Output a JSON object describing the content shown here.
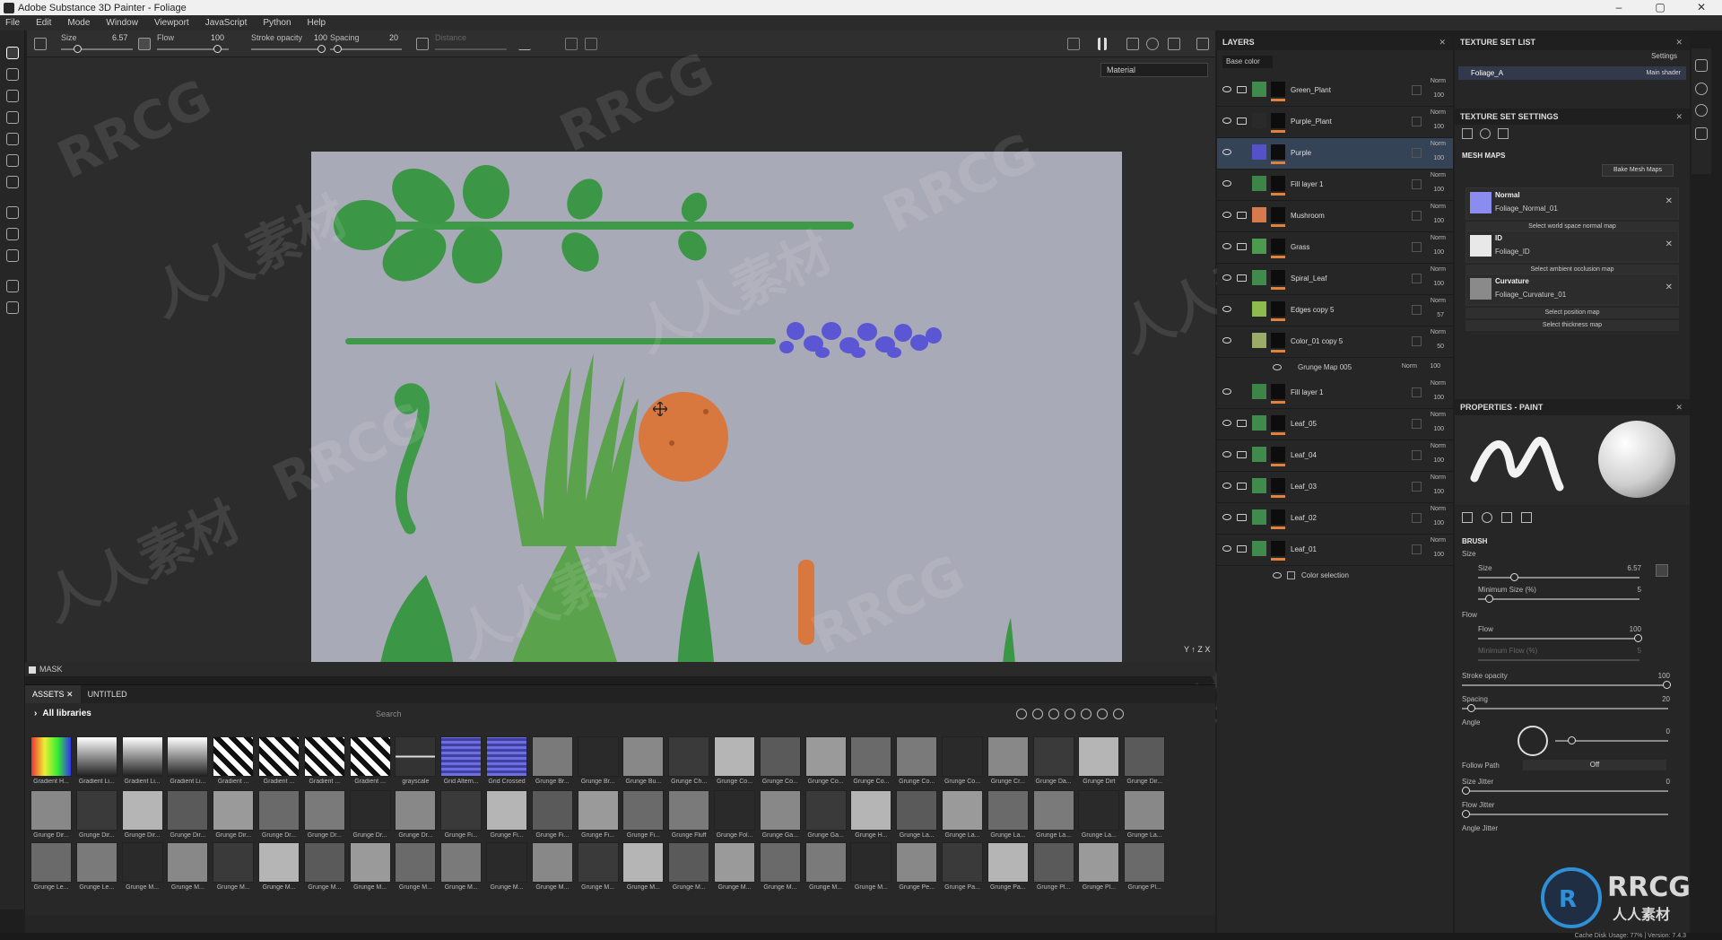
{
  "window": {
    "title": "Adobe Substance 3D Painter - Foliage",
    "min": "–",
    "max": "▢",
    "close": "✕"
  },
  "menu": [
    "File",
    "Edit",
    "Mode",
    "Window",
    "Viewport",
    "JavaScript",
    "Python",
    "Help"
  ],
  "toolbar": {
    "size_label": "Size",
    "size_value": "6.57",
    "flow_label": "Flow",
    "flow_value": "100",
    "stroke_label": "Stroke opacity",
    "stroke_value": "100",
    "spacing_label": "Spacing",
    "spacing_value": "20",
    "distance_label": "Distance"
  },
  "viewport": {
    "material_select": "Material",
    "axis_label": "Y ↑ Z X"
  },
  "watermarks": [
    "RRCG",
    "人人素材",
    "RRCG",
    "人人素材",
    "RRCG",
    "人人素材",
    "RRCG",
    "人人素材",
    "RRCG",
    "人人素材",
    "RRCG",
    "人人素材"
  ],
  "mask_bar": {
    "label": "MASK"
  },
  "assets": {
    "tabs": [
      "ASSETS",
      "UNTITLED"
    ],
    "library": "All libraries",
    "search_placeholder": "Search",
    "rows": [
      [
        "Gradient H...",
        "Gradient Li...",
        "Gradient Li...",
        "Gradient Li...",
        "Gradient ...",
        "Gradient ...",
        "Gradient ...",
        "Gradient ...",
        "grayscale",
        "Grid Altern...",
        "Grid Crossed",
        "Grunge Br...",
        "Grunge Br...",
        "Grunge Bu...",
        "Grunge Ch...",
        "Grunge Co...",
        "Grunge Co...",
        "Grunge Co...",
        "Grunge Co...",
        "Grunge Co...",
        "Grunge Co...",
        "Grunge Cr...",
        "Grunge Da...",
        "Grunge Dirt",
        "Grunge Dir..."
      ],
      [
        "Grunge Dir...",
        "Grunge Dir...",
        "Grunge Dir...",
        "Grunge Dir...",
        "Grunge Dir...",
        "Grunge Dr...",
        "Grunge Dr...",
        "Grunge Dr...",
        "Grunge Dr...",
        "Grunge Fi...",
        "Grunge Fi...",
        "Grunge Fi...",
        "Grunge Fi...",
        "Grunge Fi...",
        "Grunge Fluff",
        "Grunge Fol...",
        "Grunge Ga...",
        "Grunge Ga...",
        "Grunge H...",
        "Grunge La...",
        "Grunge La...",
        "Grunge La...",
        "Grunge La...",
        "Grunge La...",
        "Grunge La..."
      ],
      [
        "Grunge Le...",
        "Grunge Le...",
        "Grunge M...",
        "Grunge M...",
        "Grunge M...",
        "Grunge M...",
        "Grunge M...",
        "Grunge M...",
        "Grunge M...",
        "Grunge M...",
        "Grunge M...",
        "Grunge M...",
        "Grunge M...",
        "Grunge M...",
        "Grunge M...",
        "Grunge M...",
        "Grunge M...",
        "Grunge M...",
        "Grunge M...",
        "Grunge Pe...",
        "Grunge Pa...",
        "Grunge Pa...",
        "Grunge Pl...",
        "Grunge Pl...",
        "Grunge Pl..."
      ]
    ]
  },
  "layers": {
    "title": "LAYERS",
    "channel": "Base color",
    "items": [
      {
        "name": "Green_Plant",
        "color": "#3f8a4c",
        "blend": "Norm",
        "opacity": "100",
        "folder": true
      },
      {
        "name": "Purple_Plant",
        "color": "#2a2a2a",
        "blend": "Norm",
        "opacity": "100",
        "folder": true
      },
      {
        "name": "Purple",
        "color": "#5551c9",
        "blend": "Norm",
        "opacity": "100",
        "folder": false,
        "selected": true
      },
      {
        "name": "Fill layer 1",
        "color": "#3c8448",
        "blend": "Norm",
        "opacity": "100",
        "folder": false
      },
      {
        "name": "Mushroom",
        "color": "#d67a4d",
        "blend": "Norm",
        "opacity": "100",
        "folder": true
      },
      {
        "name": "Grass",
        "color": "#4c9a4d",
        "blend": "Norm",
        "opacity": "100",
        "folder": true
      },
      {
        "name": "Spiral_Leaf",
        "color": "#3f8a4c",
        "blend": "Norm",
        "opacity": "100",
        "folder": true
      },
      {
        "name": "Edges copy 5",
        "color": "#8dbb4e",
        "blend": "Norm",
        "opacity": "57",
        "folder": false
      },
      {
        "name": "Color_01 copy 5",
        "color": "#9bac68",
        "blend": "Norm",
        "opacity": "50",
        "folder": false
      }
    ],
    "sub_item": {
      "name": "Grunge Map 005",
      "blend": "Norm",
      "opacity": "100"
    },
    "items2": [
      {
        "name": "Fill layer 1",
        "color": "#3c8448",
        "blend": "Norm",
        "opacity": "100",
        "folder": false
      },
      {
        "name": "Leaf_05",
        "color": "#3f8a4c",
        "blend": "Norm",
        "opacity": "100",
        "folder": true
      },
      {
        "name": "Leaf_04",
        "color": "#3f8a4c",
        "blend": "Norm",
        "opacity": "100",
        "folder": true
      },
      {
        "name": "Leaf_03",
        "color": "#3f8a4c",
        "blend": "Norm",
        "opacity": "100",
        "folder": true
      },
      {
        "name": "Leaf_02",
        "color": "#3f8a4c",
        "blend": "Norm",
        "opacity": "100",
        "folder": true
      },
      {
        "name": "Leaf_01",
        "color": "#3f8a4c",
        "blend": "Norm",
        "opacity": "100",
        "folder": true
      }
    ],
    "footer_item": "Color selection"
  },
  "texture_set_list": {
    "title": "TEXTURE SET LIST",
    "settings": "Settings",
    "item": "Foliage_A",
    "shader": "Main shader"
  },
  "texture_set_settings": {
    "title": "TEXTURE SET SETTINGS",
    "mesh_maps": "MESH MAPS",
    "bake_button": "Bake Mesh Maps",
    "maps": [
      {
        "title": "Normal",
        "file": "Foliage_Normal_01",
        "color": "#8a8cf0",
        "select": "Select world space normal map"
      },
      {
        "title": "ID",
        "file": "Foliage_ID",
        "color": "#e8e8e8",
        "select": "Select ambient occlusion map"
      },
      {
        "title": "Curvature",
        "file": "Foliage_Curvature_01",
        "color": "#8a8a8a",
        "select": "Select position map"
      }
    ],
    "extra_select": "Select thickness map"
  },
  "properties": {
    "title": "PROPERTIES - PAINT",
    "brush": "BRUSH",
    "size_group": "Size",
    "size_label": "Size",
    "size_value": "6.57",
    "min_size_label": "Minimum Size (%)",
    "min_size_value": "5",
    "flow_group": "Flow",
    "flow_label": "Flow",
    "flow_value": "100",
    "min_flow_label": "Minimum Flow (%)",
    "min_flow_value": "5",
    "stroke_label": "Stroke opacity",
    "stroke_value": "100",
    "spacing_label": "Spacing",
    "spacing_value": "20",
    "angle_label": "Angle",
    "angle_value": "0",
    "follow_label": "Follow Path",
    "follow_value": "Off",
    "size_jitter_label": "Size Jitter",
    "size_jitter_value": "0",
    "flow_jitter_label": "Flow Jitter",
    "angle_jitter_label": "Angle Jitter"
  },
  "status": {
    "text": "Cache Disk Usage:   77%  |  Version: 7.4.3"
  },
  "logo": {
    "brand": "RRCG",
    "sub": "人人素材"
  }
}
